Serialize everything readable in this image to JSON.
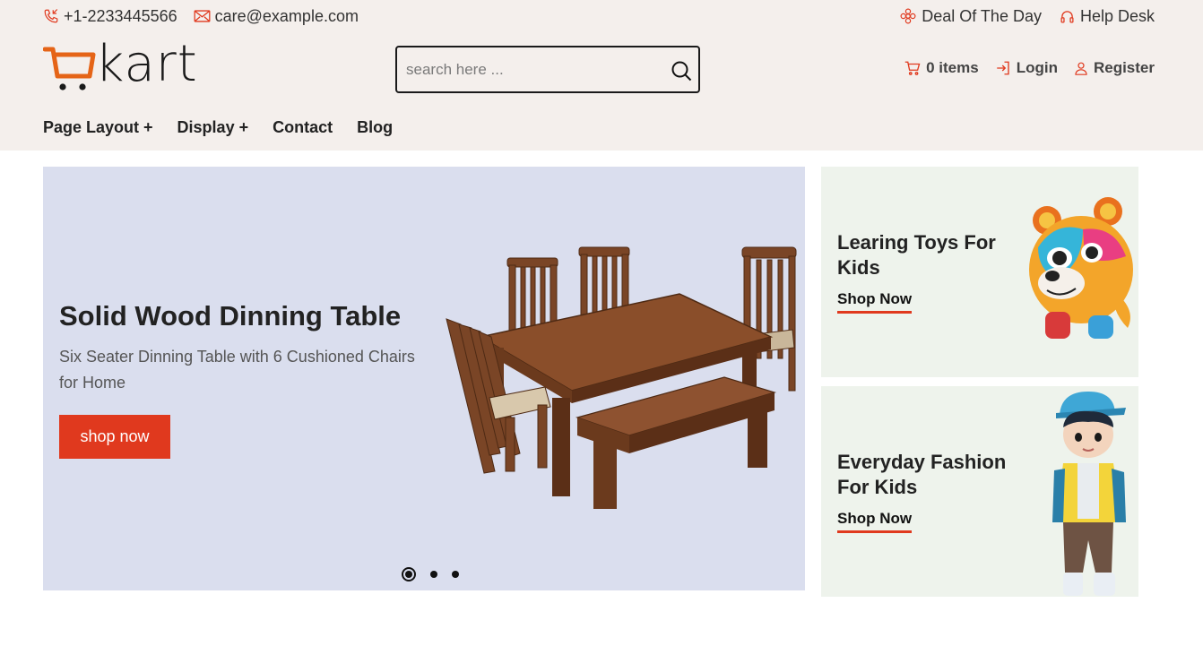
{
  "topbar": {
    "phone": "+1-2233445566",
    "email": "care@example.com",
    "deal": "Deal Of The Day",
    "help": "Help Desk"
  },
  "logo": {
    "text": "kart"
  },
  "search": {
    "placeholder": "search here ..."
  },
  "account": {
    "cart": "0 items",
    "login": "Login",
    "register": "Register"
  },
  "nav": {
    "items": [
      "Page Layout +",
      "Display +",
      "Contact",
      "Blog"
    ]
  },
  "hero": {
    "title": "Solid Wood Dinning Table",
    "subtitle": "Six Seater Dinning Table with 6 Cushioned Chairs for Home",
    "button": "shop now",
    "slides": 3,
    "active_slide": 1
  },
  "promos": [
    {
      "title": "Learing Toys For Kids",
      "link": "Shop Now"
    },
    {
      "title": "Everyday Fashion For Kids",
      "link": "Shop Now"
    }
  ],
  "colors": {
    "accent": "#e0391e",
    "header_bg": "#f4efec",
    "hero_bg": "#dadeee",
    "promo_bg": "#eef3ec"
  }
}
